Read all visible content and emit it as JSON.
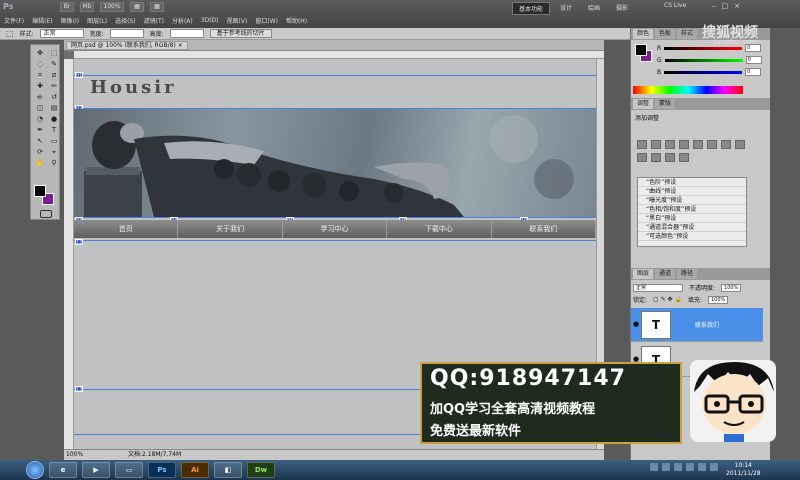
{
  "app": {
    "logo": "Ps",
    "menu": [
      "文件(F)",
      "编辑(E)",
      "图像(I)",
      "图层(L)",
      "选择(S)",
      "滤镜(T)",
      "分析(A)",
      "3D(D)",
      "视图(V)",
      "窗口(W)",
      "帮助(H)"
    ],
    "top_icons": [
      "Br",
      "Mb",
      "100%",
      "▦",
      "▦"
    ],
    "workspaces": [
      "基本功能",
      "设计",
      "绘画",
      "摄影"
    ],
    "cs_live": "CS Live",
    "window_controls": [
      "–",
      "□",
      "×"
    ]
  },
  "options": {
    "style_label": "样式:",
    "style_value": "正常",
    "width_label": "宽度:",
    "height_label": "高度:",
    "slice_button": "基于参考线的切片"
  },
  "tools": {
    "icons": [
      "move-icon",
      "marquee-icon",
      "lasso-icon",
      "quick-select-icon",
      "crop-icon",
      "slice-icon",
      "heal-icon",
      "brush-icon",
      "stamp-icon",
      "history-brush-icon",
      "eraser-icon",
      "gradient-icon",
      "blur-icon",
      "dodge-icon",
      "pen-icon",
      "type-icon",
      "path-select-icon",
      "shape-icon",
      "3d-rotate-icon",
      "3d-camera-icon",
      "hand-icon",
      "zoom-icon"
    ],
    "glyphs": [
      "✥",
      "⬚",
      "◌",
      "✎",
      "⌗",
      "⧄",
      "✚",
      "✏",
      "⎆",
      "↺",
      "◫",
      "▤",
      "◔",
      "●",
      "✒",
      "T",
      "↖",
      "▭",
      "⟳",
      "⌖",
      "✋",
      "⚲"
    ],
    "fg_color": "#000000",
    "bg_color": "#7a1f8e"
  },
  "document": {
    "tab": "网页.psd @ 100% (联系我们, RGB/8) ×",
    "zoom": "100%",
    "doc_size": "文档:2.18M/7.74M",
    "site_title": "Housir",
    "nav": [
      "首页",
      "关于我们",
      "学习中心",
      "下载中心",
      "联系我们"
    ]
  },
  "panels": {
    "color_tabs": [
      "颜色",
      "色板",
      "样式"
    ],
    "rgb_labels": [
      "R",
      "G",
      "B"
    ],
    "rgb_values": [
      "0",
      "0",
      "0"
    ],
    "adjust_tabs": [
      "调整",
      "蒙版"
    ],
    "adjust_title": "添加调整",
    "adjust_presets": [
      "“色阶”预设",
      "“曲线”预设",
      "“曝光度”预设",
      "“色相/饱和度”预设",
      "“黑白”预设",
      "“通道混合器”预设",
      "“可选颜色”预设"
    ],
    "layers_tabs": [
      "图层",
      "通道",
      "路径"
    ],
    "blend_mode": "正常",
    "opacity_label": "不透明度:",
    "opacity_value": "100%",
    "lock_label": "锁定:",
    "fill_label": "填充:",
    "fill_value": "100%",
    "layers": [
      {
        "name": "联系我们",
        "thumb": "T"
      },
      {
        "name": "",
        "thumb": "T"
      }
    ]
  },
  "overlay": {
    "watermark": "搜狐视频",
    "watermark_url": "tv.sohu.com",
    "qq": "QQ:918947147",
    "line1": "加QQ学习全套高清视频教程",
    "line2": "免费送最新软件"
  },
  "taskbar": {
    "apps": [
      "Ps",
      "Ai",
      "Dw"
    ],
    "time": "10:14",
    "date": "2011/11/28"
  }
}
